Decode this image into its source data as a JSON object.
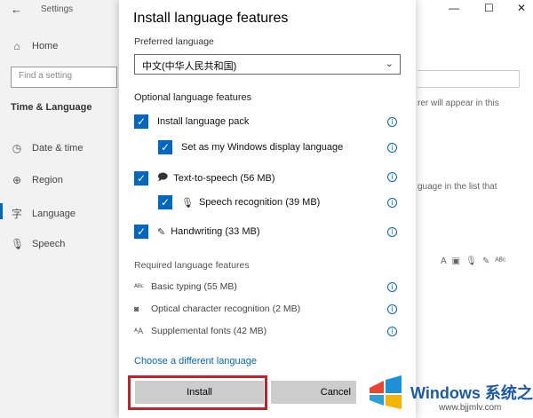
{
  "settings": {
    "window_title": "Settings",
    "sidebar": {
      "home": "Home",
      "search_placeholder": "Find a setting",
      "section": "Time & Language",
      "items": [
        {
          "label": "Date & time",
          "icon": "calendar-clock-icon"
        },
        {
          "label": "Region",
          "icon": "globe-icon"
        },
        {
          "label": "Language",
          "icon": "language-icon"
        },
        {
          "label": "Speech",
          "icon": "microphone-icon"
        }
      ]
    },
    "bg_text_1": "rer will appear in this",
    "bg_text_2": "guage in the list that"
  },
  "dialog": {
    "title": "Install language features",
    "preferred_label": "Preferred language",
    "preferred_value": "中文(中华人民共和国)",
    "optional_label": "Optional language features",
    "optional": [
      {
        "label": "Install language pack",
        "checked": true
      },
      {
        "label": "Set as my Windows display language",
        "checked": true
      },
      {
        "label": "Text-to-speech (56 MB)",
        "checked": true
      },
      {
        "label": "Speech recognition (39 MB)",
        "checked": true
      },
      {
        "label": "Handwriting (33 MB)",
        "checked": true
      }
    ],
    "required_label": "Required language features",
    "required": [
      {
        "label": "Basic typing (55 MB)",
        "icon": "abc-icon"
      },
      {
        "label": "Optical character recognition (2 MB)",
        "icon": "camera-icon"
      },
      {
        "label": "Supplemental fonts (42 MB)",
        "icon": "font-icon"
      }
    ],
    "link": "Choose a different language",
    "install_button": "Install",
    "cancel_button": "Cancel"
  },
  "watermark": {
    "brand": "Windows 系统之家",
    "url": "www.bjjmlv.com"
  },
  "colors": {
    "accent": "#0067c0",
    "highlight": "#c0242a"
  }
}
